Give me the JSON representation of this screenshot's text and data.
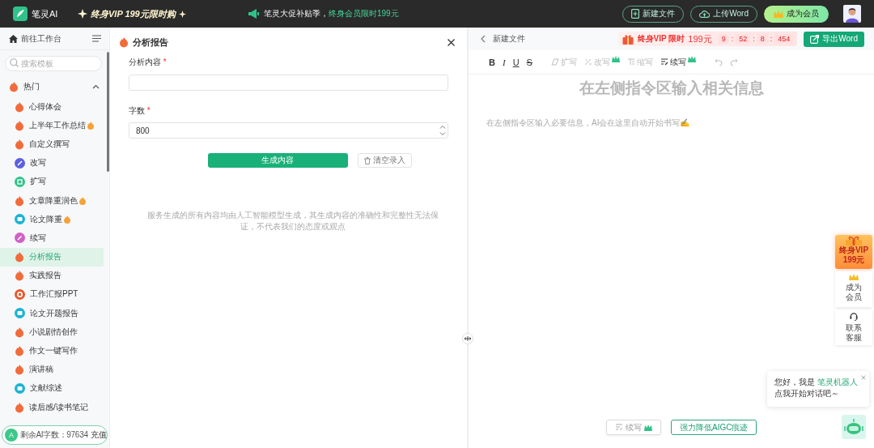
{
  "top_bar": {
    "brand": "笔灵AI",
    "promo": "终身VIP 199元限时购",
    "notice": "笔灵大促补贴季，",
    "notice_link": "终身会员限时199元",
    "buttons": [
      {
        "label": "新建文件",
        "kind": "new"
      },
      {
        "label": "上传Word",
        "kind": "upload"
      },
      {
        "label": "成为会员",
        "kind": "vip"
      }
    ]
  },
  "sidebar": {
    "home": "前往工作台",
    "search": {
      "placeholder": "搜索模板"
    },
    "group": {
      "label": "热门",
      "expanded": true
    },
    "items": [
      {
        "label": "心得体会",
        "kind": "flame",
        "hot": false,
        "selected": false
      },
      {
        "label": "上半年工作总结",
        "kind": "flame",
        "hot": true,
        "selected": false
      },
      {
        "label": "自定义撰写",
        "kind": "flame",
        "hot": false,
        "selected": false
      },
      {
        "label": "改写",
        "kind": "rewrite",
        "hot": false,
        "selected": false
      },
      {
        "label": "扩写",
        "kind": "expand",
        "hot": false,
        "selected": false
      },
      {
        "label": "文章降重润色",
        "kind": "flame",
        "hot": true,
        "selected": false
      },
      {
        "label": "论文降重",
        "kind": "paper",
        "hot": true,
        "selected": false
      },
      {
        "label": "续写",
        "kind": "continue",
        "hot": false,
        "selected": false
      },
      {
        "label": "分析报告",
        "kind": "flame",
        "hot": false,
        "selected": true
      },
      {
        "label": "实践报告",
        "kind": "flame",
        "hot": false,
        "selected": false
      },
      {
        "label": "工作汇报PPT",
        "kind": "ppt",
        "hot": false,
        "selected": false
      },
      {
        "label": "论文开题报告",
        "kind": "paper",
        "hot": false,
        "selected": false
      },
      {
        "label": "小说剧情创作",
        "kind": "flame",
        "hot": false,
        "selected": false
      },
      {
        "label": "作文一键写作",
        "kind": "flame",
        "hot": false,
        "selected": false
      },
      {
        "label": "演讲稿",
        "kind": "flame",
        "hot": false,
        "selected": false
      },
      {
        "label": "文献综述",
        "kind": "paper",
        "hot": false,
        "selected": false
      },
      {
        "label": "读后感/读书笔记",
        "kind": "flame",
        "hot": false,
        "selected": false
      }
    ],
    "footer": {
      "badge": "A",
      "quota": "剩余AI字数：97634",
      "action": "充值"
    }
  },
  "form": {
    "title": "分析报告",
    "required_mark": "*",
    "fields": [
      {
        "label": "分析内容",
        "required": true,
        "kind": "text"
      },
      {
        "label": "字数",
        "required": true,
        "kind": "number",
        "value": "800"
      }
    ],
    "submit": "生成内容",
    "clear": "清空录入",
    "disclaimer": "服务生成的所有内容均由人工智能模型生成，其生成内容的准确性和完整性无法保证，不代表我们的态度或观点"
  },
  "editor": {
    "back_title": "新建文件",
    "offer": {
      "label": "终身VIP 限时",
      "price": "199元",
      "countdown": [
        "9",
        "52",
        "8",
        "454"
      ],
      "separator": ":"
    },
    "export": "导出Word",
    "toolbar": [
      {
        "label": "B",
        "kind": "bold",
        "disabled": false
      },
      {
        "label": "I",
        "kind": "italic",
        "disabled": false
      },
      {
        "label": "U",
        "kind": "underline",
        "disabled": false
      },
      {
        "label": "S",
        "kind": "strike",
        "disabled": false
      },
      {
        "label": "扩写",
        "kind": "expand",
        "disabled": true,
        "crown": false
      },
      {
        "label": "改写",
        "kind": "rewrite",
        "disabled": true,
        "crown": true
      },
      {
        "label": "缩写",
        "kind": "shorten",
        "disabled": true,
        "crown": false
      },
      {
        "label": "续写",
        "kind": "continue",
        "disabled": false,
        "crown": true
      },
      {
        "kind": "undo",
        "disabled": true
      },
      {
        "kind": "redo",
        "disabled": true
      }
    ],
    "heading": "在左侧指令区输入相关信息",
    "hint": "在左侧指令区输入必要信息，AI会在这里自动开始书写✍️",
    "bottom_buttons": [
      {
        "label": "续写",
        "kind": "continue",
        "crown": true
      },
      {
        "label": "强力降低AIGC痕迹",
        "kind": "aigc",
        "crown": false
      }
    ]
  },
  "float": {
    "gift": {
      "label": "终身VIP",
      "price": "199元"
    },
    "cards": [
      {
        "label": "成为会员",
        "kind": "vip"
      },
      {
        "label": "联系客服",
        "kind": "service"
      }
    ],
    "chat": {
      "greeting": "您好，我是 ",
      "bot_name": "笔灵机器人",
      "prompt": "点我开始对话吧～"
    }
  }
}
